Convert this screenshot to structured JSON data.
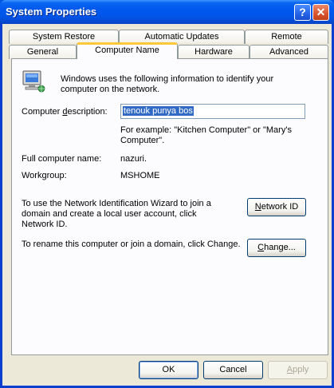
{
  "window": {
    "title": "System Properties",
    "help_glyph": "?",
    "close_glyph": "✕"
  },
  "tabs": {
    "row1": [
      "System Restore",
      "Automatic Updates",
      "Remote"
    ],
    "row2": [
      "General",
      "Computer Name",
      "Hardware",
      "Advanced"
    ],
    "active": "Computer Name"
  },
  "computer_name": {
    "intro": "Windows uses the following information to identify your computer on the network.",
    "description_label": "Computer description:",
    "description_label_pre": "Computer ",
    "description_label_accel": "d",
    "description_label_post": "escription:",
    "description_value": "tenouk punya bos",
    "example": "For example: \"Kitchen Computer\" or \"Mary's Computer\".",
    "full_name_label": "Full computer name:",
    "full_name_value": "nazuri.",
    "workgroup_label": "Workgroup:",
    "workgroup_value": "MSHOME",
    "network_id_text": "To use the Network Identification Wizard to join a domain and create a local user account, click Network ID.",
    "network_id_button_accel": "N",
    "network_id_button_rest": "etwork ID",
    "rename_text": "To rename this computer or join a domain, click Change.",
    "change_button_accel": "C",
    "change_button_rest": "hange..."
  },
  "footer": {
    "ok": "OK",
    "cancel": "Cancel",
    "apply_accel": "A",
    "apply_rest": "pply"
  }
}
